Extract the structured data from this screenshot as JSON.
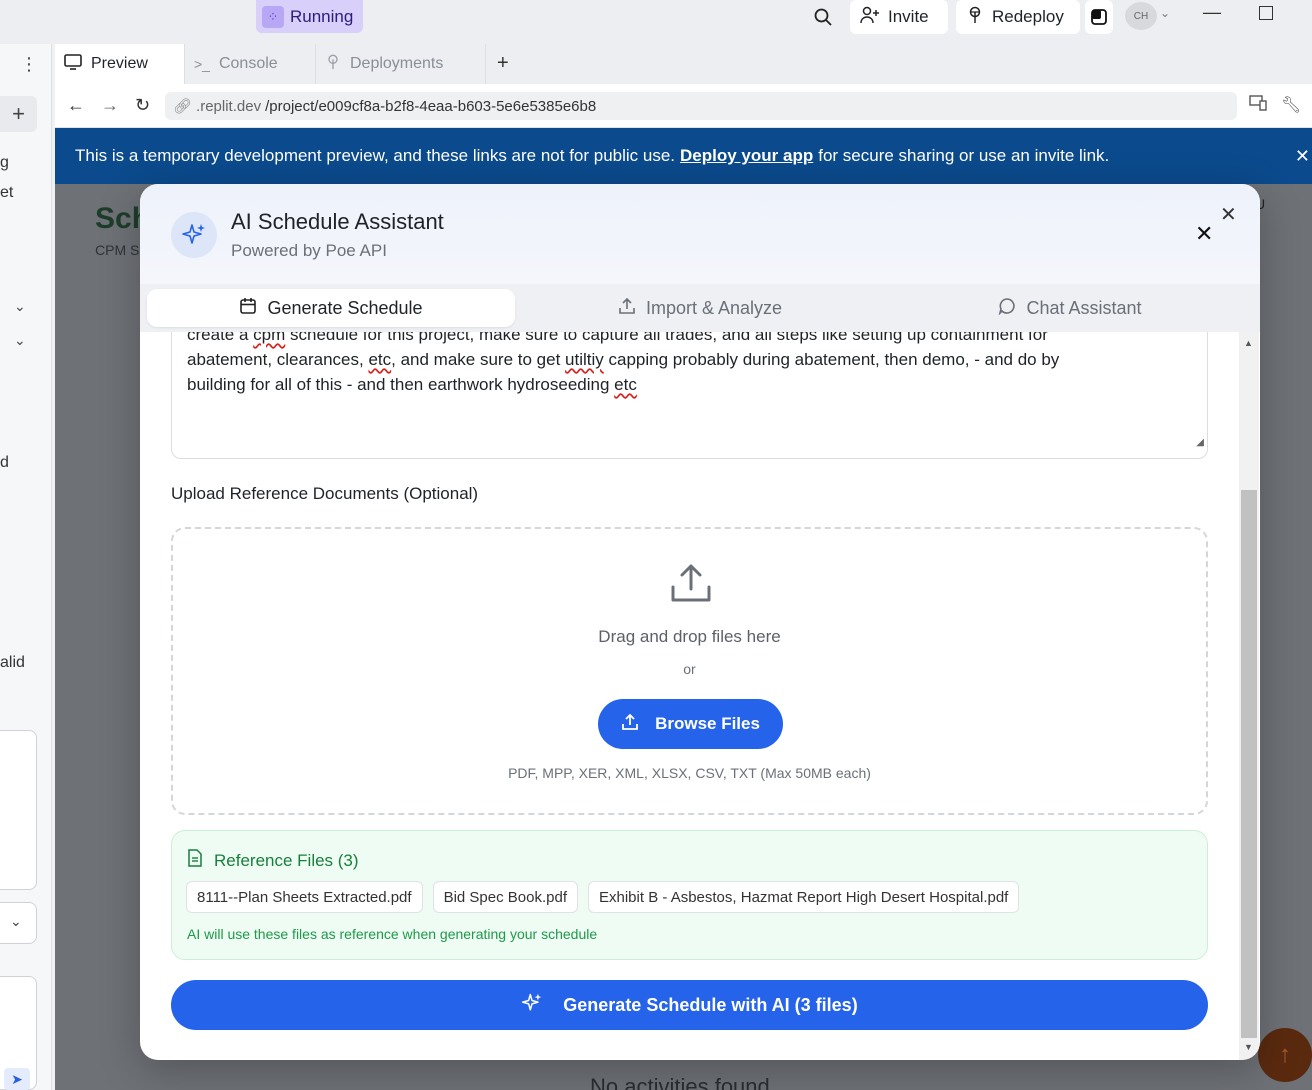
{
  "topbar": {
    "running_label": "Running",
    "invite_label": "Invite",
    "redeploy_label": "Redeploy",
    "avatar_initials": "CH"
  },
  "leftstrip": {
    "fragment_1": "g",
    "fragment_2": "et",
    "fragment_3": "d",
    "fragment_4": "alid"
  },
  "tabs": [
    {
      "label": "Preview",
      "icon": "monitor-icon",
      "active": true
    },
    {
      "label": "Console",
      "icon": "terminal-icon",
      "active": false
    },
    {
      "label": "Deployments",
      "icon": "deploy-icon",
      "active": false
    }
  ],
  "address": {
    "url_domain": ".replit.dev",
    "url_path": "/project/e009cf8a-b2f8-4eaa-b603-5e6e5385e6b8"
  },
  "banner": {
    "text_before": "This is a temporary development preview, and these links are not for public use.",
    "link_text": "Deploy your app",
    "text_after": "for secure sharing or use an invite link."
  },
  "background_app": {
    "title": "Sch",
    "subtitle": "CPM S",
    "badge": "U",
    "empty_text": "No activities found"
  },
  "modal": {
    "title": "AI Schedule Assistant",
    "subtitle": "Powered by Poe API",
    "tabs": [
      {
        "label": "Generate Schedule",
        "active": true
      },
      {
        "label": "Import & Analyze",
        "active": false
      },
      {
        "label": "Chat Assistant",
        "active": false
      }
    ],
    "prompt_text_line1_a": "create a ",
    "prompt_text_line1_sp": "cpm",
    "prompt_text_line1_b": " schedule for this project, make sure to capture all trades, and all steps like setting up containment for",
    "prompt_text_line2_a": "abatement, clearances, ",
    "prompt_text_line2_sp1": "etc",
    "prompt_text_line2_b": ", and make sure to get ",
    "prompt_text_line2_sp2": "utiltiy",
    "prompt_text_line2_c": " capping probably during abatement, then demo, - and do by",
    "prompt_text_line3_a": "building for all of this - and then earthwork hydroseeding ",
    "prompt_text_line3_sp": "etc",
    "upload_label": "Upload Reference Documents (Optional)",
    "dropzone_title": "Drag and drop files here",
    "dropzone_or": "or",
    "browse_label": "Browse Files",
    "formats": "PDF, MPP, XER, XML, XLSX, CSV, TXT (Max 50MB each)",
    "reference_title": "Reference Files (3)",
    "reference_files": [
      "8111--Plan Sheets Extracted.pdf",
      "Bid Spec Book.pdf",
      "Exhibit B - Asbestos, Hazmat Report High Desert Hospital.pdf"
    ],
    "reference_note": "AI will use these files as reference when generating your schedule",
    "generate_label": "Generate Schedule with AI (3 files)"
  },
  "colors": {
    "primary": "#2563eb",
    "banner": "#0b4a8c",
    "success": "#17803d"
  }
}
